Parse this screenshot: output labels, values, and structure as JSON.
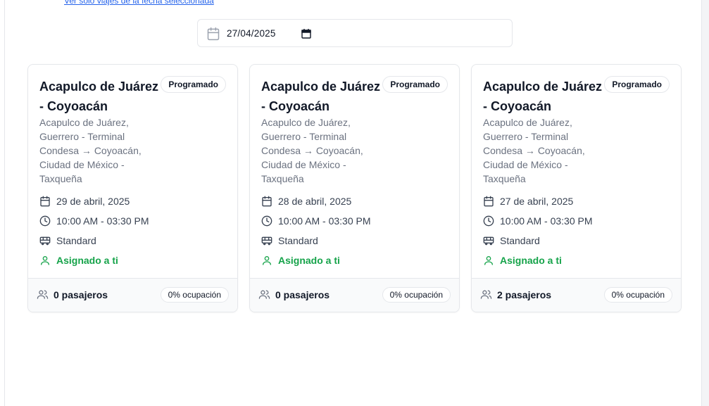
{
  "filter_link": "Ver solo viajes de la fecha seleccionada",
  "date_picker": {
    "value": "27/04/2025"
  },
  "icons": {
    "calendar": "calendar-icon",
    "clock": "clock-icon",
    "bus": "bus-icon",
    "user": "user-icon",
    "users": "users-icon"
  },
  "colors": {
    "assigned": "#16a34a",
    "link": "#2563eb",
    "muted": "#6b7280"
  },
  "trips": [
    {
      "title": "Acapulco de Juárez - Coyoacán",
      "status": "Programado",
      "route": "Acapulco de Juárez, Guerrero - Terminal Condesa → Coyoacán, Ciudad de México - Taxqueña",
      "date": "29 de abril, 2025",
      "time": "10:00 AM - 03:30 PM",
      "type": "Standard",
      "assigned": "Asignado a ti",
      "passengers": "0 pasajeros",
      "occupancy": "0% ocupación"
    },
    {
      "title": "Acapulco de Juárez - Coyoacán",
      "status": "Programado",
      "route": "Acapulco de Juárez, Guerrero - Terminal Condesa → Coyoacán, Ciudad de México - Taxqueña",
      "date": "28 de abril, 2025",
      "time": "10:00 AM - 03:30 PM",
      "type": "Standard",
      "assigned": "Asignado a ti",
      "passengers": "0 pasajeros",
      "occupancy": "0% ocupación"
    },
    {
      "title": "Acapulco de Juárez - Coyoacán",
      "status": "Programado",
      "route": "Acapulco de Juárez, Guerrero - Terminal Condesa → Coyoacán, Ciudad de México - Taxqueña",
      "date": "27 de abril, 2025",
      "time": "10:00 AM - 03:30 PM",
      "type": "Standard",
      "assigned": "Asignado a ti",
      "passengers": "2 pasajeros",
      "occupancy": "0% ocupación"
    }
  ]
}
